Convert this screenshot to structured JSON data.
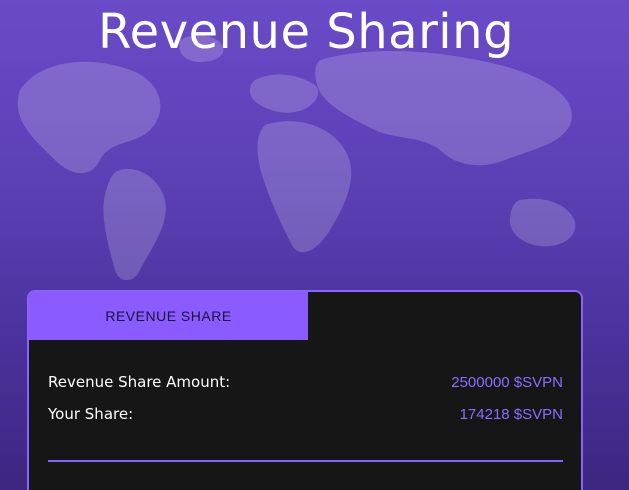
{
  "page": {
    "title": "Revenue Sharing"
  },
  "card": {
    "tabs": [
      {
        "label": "REVENUE SHARE",
        "active": true
      }
    ],
    "rows": [
      {
        "label": "Revenue Share Amount:",
        "value": "2500000 $SVPN"
      },
      {
        "label": "Your Share:",
        "value": "174218 $SVPN"
      }
    ]
  },
  "colors": {
    "accent": "#8a5cff",
    "card_bg": "#161616",
    "value_text": "#8f6bff",
    "background_top": "#6a4bc8",
    "background_bottom": "#3c2680"
  },
  "icons": {
    "background": "world-map-icon"
  }
}
